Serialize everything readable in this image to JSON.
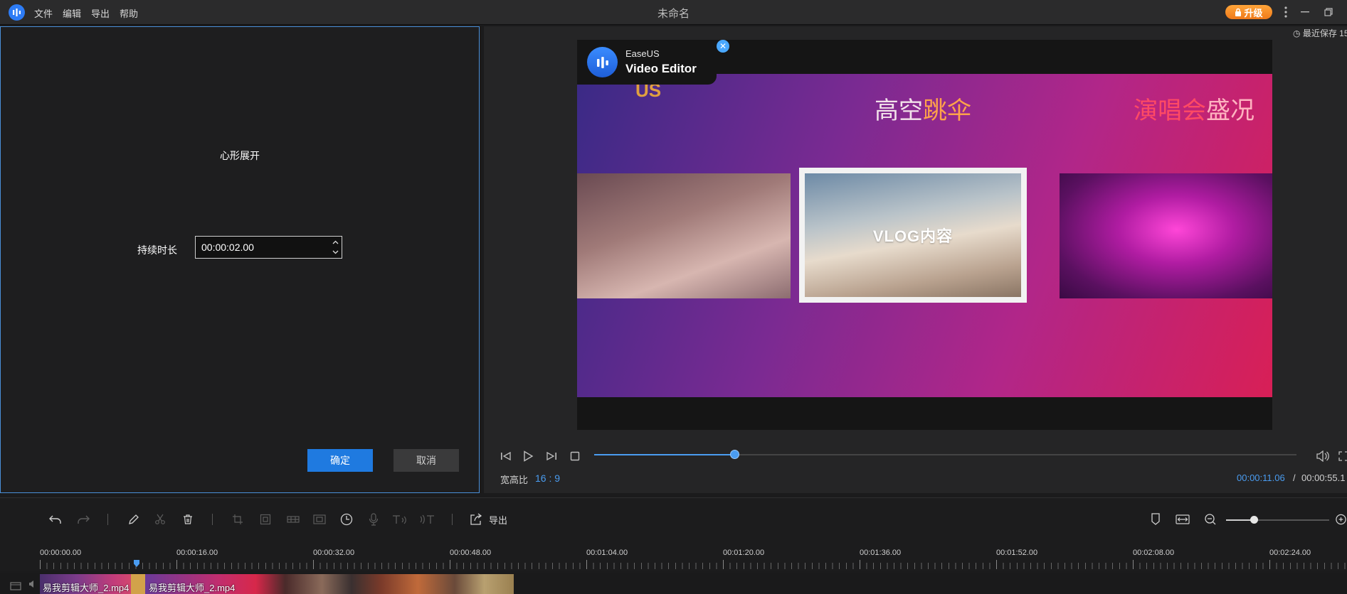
{
  "titlebar": {
    "menu": [
      "文件",
      "编辑",
      "导出",
      "帮助"
    ],
    "title": "未命名",
    "upgrade_label": "升级"
  },
  "dialog": {
    "effect_name": "心形展开",
    "duration_label": "持续时长",
    "duration_value": "00:00:02.00",
    "ok_label": "确定",
    "cancel_label": "取消"
  },
  "preview": {
    "save_status": "最近保存 15",
    "ad_line1": "EaseUS",
    "ad_line2": "Video Editor",
    "video_text_us": "US",
    "video_text_a1": "高空",
    "video_text_a2": "跳伞",
    "video_text_b1": "演唱会",
    "video_text_b2": "盛况",
    "video_center_text": "VLOG内容",
    "progress": 0.2,
    "aspect_label": "宽高比",
    "aspect_value": "16 : 9",
    "time_current": "00:00:11.06",
    "time_separator": "/",
    "time_total": "00:00:55.1"
  },
  "toolbar": {
    "export_label": "导出"
  },
  "ruler": {
    "labels": [
      "00:00:00.00",
      "00:00:16.00",
      "00:00:32.00",
      "00:00:48.00",
      "00:01:04.00",
      "00:01:20.00",
      "00:01:36.00",
      "00:01:52.00",
      "00:02:08.00",
      "00:02:24.00"
    ]
  },
  "track": {
    "clip1_label": "易我剪辑大师_2.mp4",
    "clip2_label": "易我剪辑大师_2.mp4"
  },
  "colors": {
    "accent": "#4a9cf0",
    "primary_button": "#1f7ae0",
    "upgrade": "#f08a25"
  }
}
